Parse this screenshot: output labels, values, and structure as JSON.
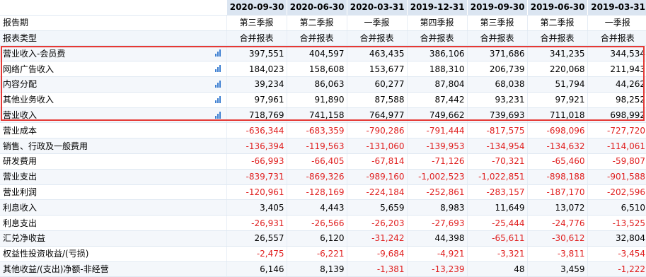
{
  "header": {
    "dates": [
      "2020-09-30",
      "2020-06-30",
      "2020-03-31",
      "2019-12-31",
      "2019-09-30",
      "2019-06-30",
      "2019-03-31"
    ]
  },
  "meta_rows": [
    {
      "label": "报告期",
      "values": [
        "第三季报",
        "第二季报",
        "一季报",
        "第四季报",
        "第三季报",
        "第二季报",
        "一季报"
      ]
    },
    {
      "label": "报表类型",
      "values": [
        "合并报表",
        "合并报表",
        "合并报表",
        "合并报表",
        "合并报表",
        "合并报表",
        "合并报表"
      ]
    }
  ],
  "rows": [
    {
      "label": "营业收入-会员费",
      "values": [
        "397,551",
        "404,597",
        "463,435",
        "386,106",
        "371,686",
        "341,235",
        "344,534"
      ],
      "chart_icon": "bar-chart-icon"
    },
    {
      "label": "网络广告收入",
      "values": [
        "184,023",
        "158,608",
        "153,677",
        "188,310",
        "206,739",
        "220,068",
        "211,943"
      ],
      "chart_icon": "bar-chart-icon"
    },
    {
      "label": "内容分配",
      "values": [
        "39,234",
        "86,063",
        "60,277",
        "87,804",
        "68,038",
        "51,794",
        "44,262"
      ],
      "chart_icon": "bar-chart-icon"
    },
    {
      "label": "其他业务收入",
      "values": [
        "97,961",
        "91,890",
        "87,588",
        "87,442",
        "93,231",
        "97,921",
        "98,252"
      ],
      "chart_icon": "bar-chart-icon"
    },
    {
      "label": "营业收入",
      "values": [
        "718,769",
        "741,158",
        "764,977",
        "749,662",
        "739,693",
        "711,018",
        "698,992"
      ],
      "chart_icon": "bar-chart-icon"
    },
    {
      "label": "营业成本",
      "values": [
        "-636,344",
        "-683,359",
        "-790,286",
        "-791,444",
        "-817,575",
        "-698,096",
        "-727,720"
      ]
    },
    {
      "label": "销售、行政及一般费用",
      "values": [
        "-136,394",
        "-119,563",
        "-131,060",
        "-139,953",
        "-134,954",
        "-134,632",
        "-114,061"
      ]
    },
    {
      "label": "研发费用",
      "values": [
        "-66,993",
        "-66,405",
        "-67,814",
        "-71,126",
        "-70,321",
        "-65,460",
        "-59,807"
      ]
    },
    {
      "label": "营业支出",
      "values": [
        "-839,731",
        "-869,326",
        "-989,160",
        "-1,002,523",
        "-1,022,851",
        "-898,188",
        "-901,588"
      ]
    },
    {
      "label": "营业利润",
      "values": [
        "-120,961",
        "-128,169",
        "-224,184",
        "-252,861",
        "-283,157",
        "-187,170",
        "-202,596"
      ]
    },
    {
      "label": "利息收入",
      "values": [
        "3,405",
        "4,443",
        "5,659",
        "8,983",
        "11,649",
        "13,072",
        "6,510"
      ]
    },
    {
      "label": "利息支出",
      "values": [
        "-26,931",
        "-26,566",
        "-26,203",
        "-27,693",
        "-25,444",
        "-24,776",
        "-13,525"
      ]
    },
    {
      "label": "汇兑净收益",
      "values": [
        "26,557",
        "6,120",
        "-31,242",
        "44,398",
        "-65,611",
        "-30,612",
        "32,804"
      ]
    },
    {
      "label": "权益性投资收益/(亏损)",
      "values": [
        "-2,475",
        "-6,221",
        "-9,684",
        "-4,921",
        "-3,321",
        "-3,811",
        "-3,454"
      ]
    },
    {
      "label": "其他收益/(支出)净额-非经营",
      "values": [
        "6,146",
        "8,139",
        "-1,381",
        "-13,239",
        "48",
        "3,459",
        "-1,222"
      ]
    }
  ],
  "colors": {
    "negative": "#e02020",
    "header_bg": "#dbe5f1",
    "highlight": "#e53935",
    "icon": "#3d7fd1"
  }
}
